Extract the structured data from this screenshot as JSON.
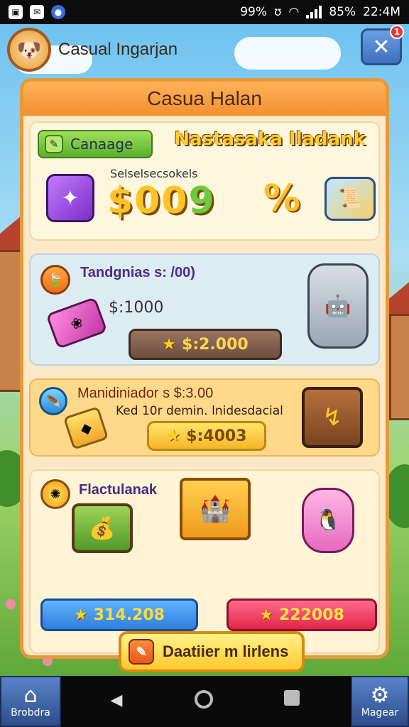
{
  "status": {
    "time": "22:4M",
    "battery": "85%",
    "left_percent": "99%"
  },
  "topbar": {
    "game_title": "Casual Ingarjan",
    "close_badge": "1"
  },
  "panel": {
    "title": "Casua Halan",
    "section1": {
      "tag": "Canaage",
      "promo_title": "Nastasaka Iladank",
      "small_label": "Selselsecsokels",
      "big_price": "$00",
      "big_price_tail": "9"
    },
    "section2": {
      "title": "Tandgnias s: /00)",
      "subprice": "$:1000",
      "price": "$:2.000"
    },
    "section3": {
      "title": "Manidiniador s $:3.00",
      "sub": "Ked 10r demin. lnidesdacial",
      "price": "$:4003"
    },
    "section4": {
      "title": "Flactulanak",
      "price_left": "314.208",
      "price_right": "222008"
    },
    "main_button": "Daatiier m lirlens"
  },
  "nav": {
    "home_label": "Brobdra",
    "settings_label": "Magear"
  },
  "colors": {
    "panel_border": "#e59a3a",
    "header": "#f2902f",
    "accent_gold": "#ffc323"
  }
}
